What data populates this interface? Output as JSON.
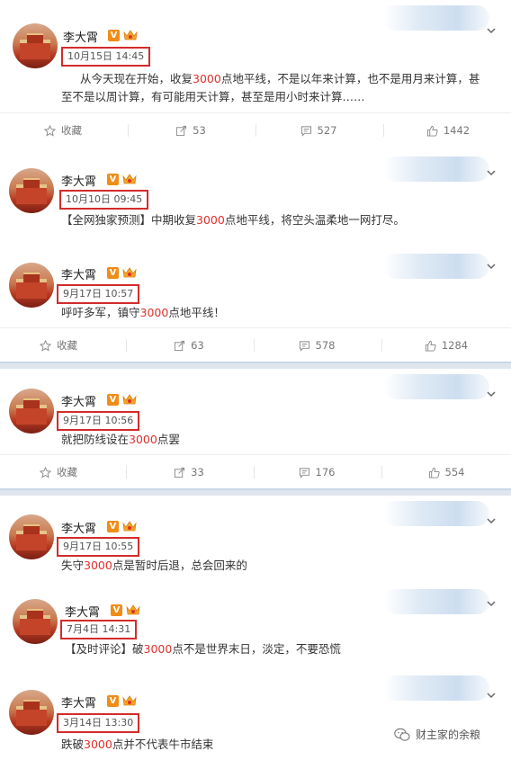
{
  "posts": [
    {
      "user": "李大霄",
      "time": "10月15日 14:45",
      "text_parts": [
        "从今天现在开始，收复",
        "3000",
        "点地平线，不是以年来计算，也不是用月来计算，甚"
      ],
      "text_line2": "至不是以周计算，有可能用天计算，甚至是用小时来计算……",
      "actions": {
        "favorite": "收藏",
        "repost": "53",
        "comment": "527",
        "like": "1442"
      }
    },
    {
      "user": "李大霄",
      "time": "10月10日 09:45",
      "text_parts": [
        "【全网独家预测】中期收复",
        "3000",
        "点地平线，将空头温柔地一网打尽。"
      ]
    },
    {
      "user": "李大霄",
      "time": "9月17日 10:57",
      "text_parts": [
        "呼吁多军，镇守",
        "3000",
        "点地平线！"
      ],
      "actions": {
        "favorite": "收藏",
        "repost": "63",
        "comment": "578",
        "like": "1284"
      }
    },
    {
      "user": "李大霄",
      "time": "9月17日 10:56",
      "text_parts": [
        "就把防线设在",
        "3000",
        "点罢"
      ],
      "actions": {
        "favorite": "收藏",
        "repost": "33",
        "comment": "176",
        "like": "554"
      }
    },
    {
      "user": "李大霄",
      "time": "9月17日 10:55",
      "text_parts": [
        "失守",
        "3000",
        "点是暂时后退，总会回来的"
      ]
    },
    {
      "user": "李大霄",
      "time": "7月4日 14:31",
      "text_parts": [
        "【及时评论】破",
        "3000",
        "点不是世界末日，淡定，不要恐慌"
      ]
    },
    {
      "user": "李大霄",
      "time": "3月14日 13:30",
      "text_parts": [
        "跌破",
        "3000",
        "点并不代表牛市结束"
      ]
    }
  ],
  "watermark": "财主家的余粮",
  "colors": {
    "highlight": "#e0302b",
    "box": "#d32b2b",
    "vip": "#f18c16",
    "divider": "#dfe6ee"
  }
}
